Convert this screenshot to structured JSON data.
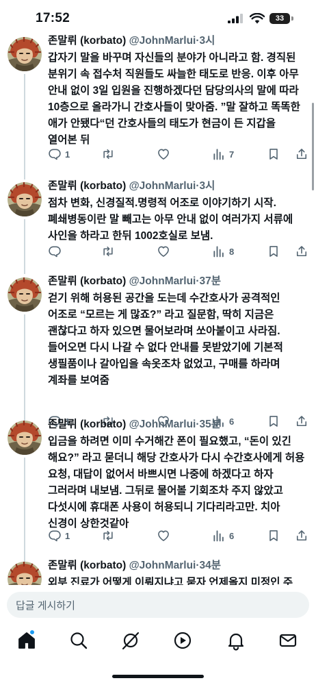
{
  "status_bar": {
    "time": "17:52",
    "battery": "33"
  },
  "tweets": [
    {
      "author": "존말뤼 (korbato)",
      "handle": "@JohnMarlui",
      "sep": "·",
      "time": "3시",
      "text": "갑자기 말을 바꾸며 자신들의 분야가 아니라고 함. 경직된 분위기 속 접수처 직원들도 싸늘한 태도로 반응. 이후 아무 안내 없이 3일 입원을 진행하겠다던 담당의사의 말에 따라 10층으로 올라가니 간호사들이 맞아줌. ”말 잘하고 똑똑한 애가 안됐다“던 간호사들의 태도가 현금이 든 지갑을 열어본 뒤",
      "replies": "1",
      "retweets": "",
      "likes": "",
      "views": "7"
    },
    {
      "author": "존말뤼 (korbato)",
      "handle": "@JohnMarlui",
      "sep": "·",
      "time": "3시",
      "text": "점차 변화, 신경질적.명령적 어조로 이야기하기 시작. 폐쇄병동이란 말 빼고는 아무 안내 없이 여러가지 서류에 사인을 하라고 한뒤 1002호실로 보냄.",
      "replies": "",
      "retweets": "",
      "likes": "",
      "views": "8"
    },
    {
      "author": "존말뤼 (korbato)",
      "handle": "@JohnMarlui",
      "sep": "·",
      "time": "37분",
      "text": "걷기 위해 허용된 공간을 도는데 수간호사가 공격적인 어조로 “모르는 게 많죠?” 라고 질문함, 딱히 지금은 괜찮다고 하자 있으면 물어보라며 쏘아붙이고 사라짐. 들어오면 다시 나갈 수 없다 안내를 못받았기에 기본적 생필품이나 갈아입을 속옷조차 없었고, 구매를 하라며 계좌를 보여줌",
      "replies": "1",
      "retweets": "",
      "likes": "",
      "views": "6"
    },
    {
      "author": "존말뤼 (korbato)",
      "handle": "@JohnMarlui",
      "sep": "·",
      "time": "35분",
      "text": "입금을 하려면 이미 수거해간 폰이 필요했고, “돈이 있긴 해요?” 라고 묻더니 해당 간호사가 다시 수간호사에게 허용 요청, 대답이 없어서 바쁘시면 나중에 하겠다고 하자 그러라며 내보냄. 그뒤로 물어볼 기회조차 주지 않았고 다섯시에 휴대폰 사용이 허용되니 기다리라고만. 치아 신경이 상한것같아",
      "replies": "1",
      "retweets": "",
      "likes": "",
      "views": "6"
    },
    {
      "author": "존말뤼 (korbato)",
      "handle": "@JohnMarlui",
      "sep": "·",
      "time": "34분",
      "text": "외부 진료가 어떻게 이뤄지냐고 묻자 언제올지 미정인 주",
      "replies": "",
      "retweets": "",
      "likes": "",
      "views": ""
    }
  ],
  "reply_bar": {
    "placeholder": "답글 게시하기"
  },
  "icons": {
    "reply": "reply-icon",
    "retweet": "retweet-icon",
    "like": "heart-icon",
    "views": "views-icon",
    "bookmark": "bookmark-icon",
    "share": "share-icon"
  },
  "nav": [
    "home-icon",
    "search-icon",
    "grok-icon",
    "video-icon",
    "notifications-icon",
    "messages-icon"
  ],
  "colors": {
    "text": "#0f1419",
    "secondary": "#536471",
    "accent": "#1d9bf0",
    "divider": "#cfd9de",
    "input_bg": "#eff3f4"
  }
}
